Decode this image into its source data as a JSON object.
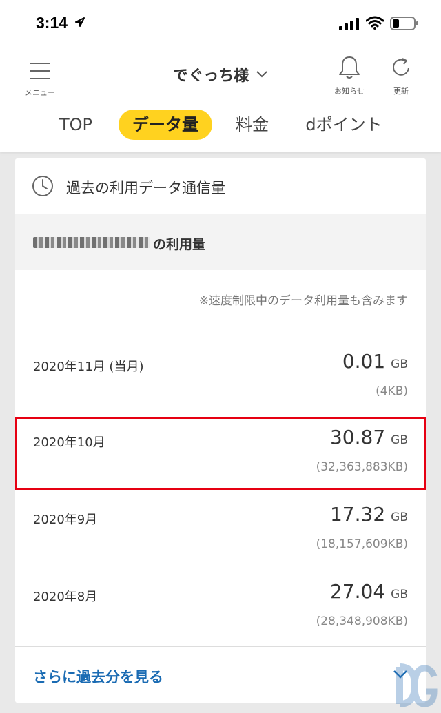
{
  "status_bar": {
    "time": "3:14"
  },
  "header": {
    "menu_label": "メニュー",
    "account_name": "でぐっち様",
    "notice_label": "お知らせ",
    "refresh_label": "更新"
  },
  "tabs": [
    {
      "label": "TOP",
      "active": false
    },
    {
      "label": "データ量",
      "active": true
    },
    {
      "label": "料金",
      "active": false
    },
    {
      "label": "dポイント",
      "active": false
    }
  ],
  "card": {
    "title": "過去の利用データ通信量",
    "line_usage_suffix": "の利用量",
    "note": "※速度制限中のデータ利用量も含みます",
    "rows": [
      {
        "month": "2020年11月 (当月)",
        "amount": "0.01",
        "unit": "GB",
        "kb": "(4KB)"
      },
      {
        "month": "2020年10月",
        "amount": "30.87",
        "unit": "GB",
        "kb": "(32,363,883KB)",
        "highlighted": true
      },
      {
        "month": "2020年9月",
        "amount": "17.32",
        "unit": "GB",
        "kb": "(18,157,609KB)"
      },
      {
        "month": "2020年8月",
        "amount": "27.04",
        "unit": "GB",
        "kb": "(28,348,908KB)"
      }
    ],
    "more_label": "さらに過去分を見る"
  },
  "colors": {
    "accent_yellow": "#ffd21f",
    "link_blue": "#1a6bb3",
    "highlight_red": "#e60012"
  },
  "icons": [
    "location-arrow-icon",
    "signal-icon",
    "wifi-icon",
    "battery-icon",
    "hamburger-icon",
    "chevron-down-icon",
    "bell-icon",
    "refresh-icon",
    "clock-icon"
  ]
}
